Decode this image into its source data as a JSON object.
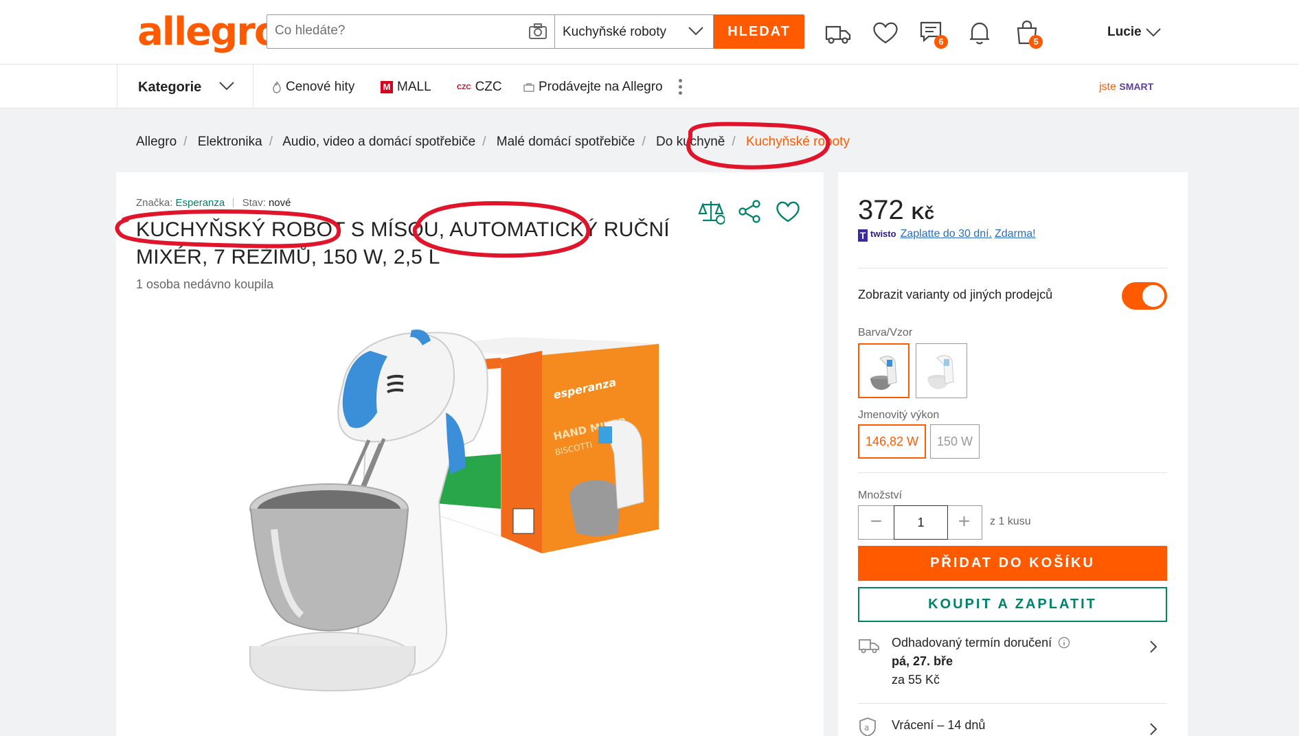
{
  "header": {
    "logo": "allegro",
    "search_placeholder": "Co hledáte?",
    "category_select": "Kuchyňské roboty",
    "search_button": "HLEDAT",
    "messages_badge": "6",
    "cart_badge": "5",
    "user_name": "Lucie"
  },
  "nav": {
    "categories": "Kategorie",
    "items": [
      "Cenové hity",
      "MALL",
      "CZC",
      "Prodávejte na Allegro"
    ],
    "mall_icon": "M",
    "czc_icon": "CZC",
    "smart_prefix": "jste",
    "smart_brand": "SMART"
  },
  "breadcrumb": {
    "items": [
      "Allegro",
      "Elektronika",
      "Audio, video a domácí spotřebiče",
      "Malé domácí spotřebiče",
      "Do kuchyně"
    ],
    "current": "Kuchyňské roboty"
  },
  "product": {
    "brand_label": "Značka:",
    "brand": "Esperanza",
    "condition_label": "Stav:",
    "condition": "nové",
    "title": "KUCHYŇSKÝ ROBOT S MÍSOU, AUTOMATICKÝ RUČNÍ MIXÉR, 7 REŽIMŮ, 150 W, 2,5 L",
    "bought": "1 osoba nedávno koupila",
    "image_box_brand": "esperanza",
    "image_box_text": [
      "HAND MIXER",
      "BISCOTTI"
    ]
  },
  "buy": {
    "price": "372",
    "currency": "Kč",
    "twisto_name": "twisto",
    "twisto_link1": "Zaplatte do 30 dní.",
    "twisto_link2": "Zdarma!",
    "variants_toggle_label": "Zobrazit varianty od jiných prodejců",
    "color_label": "Barva/Vzor",
    "power_label": "Jmenovitý výkon",
    "power_options": [
      "146,82 W",
      "150 W"
    ],
    "qty_label": "Množství",
    "qty_value": "1",
    "qty_minus": "−",
    "qty_plus": "+",
    "qty_of": "z 1 kusu",
    "add_to_cart": "PŘIDAT DO KOŠÍKU",
    "buy_now": "KOUPIT A ZAPLATIT",
    "delivery_label": "Odhadovaný termín doručení",
    "delivery_date": "pá, 27. bře",
    "delivery_price": "za 55 Kč",
    "returns": "Vrácení – 14 dnů"
  },
  "colors": {
    "accent": "#ff5a00",
    "teal": "#00816a",
    "marker": "#e0142b",
    "background": "#f1f2f4"
  }
}
